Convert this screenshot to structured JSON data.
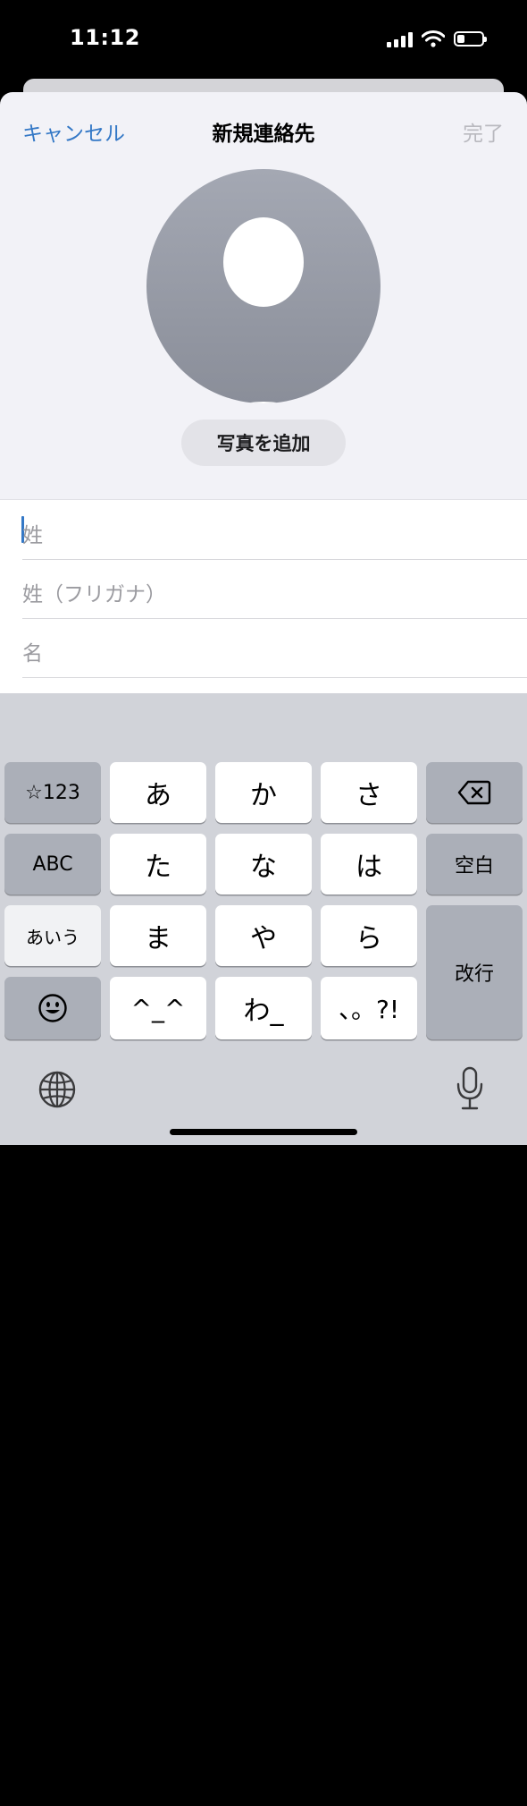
{
  "status_bar": {
    "time": "11:12"
  },
  "nav": {
    "cancel_label": "キャンセル",
    "title": "新規連絡先",
    "done_label": "完了"
  },
  "photo": {
    "add_label": "写真を追加"
  },
  "fields": [
    {
      "label": "姓"
    },
    {
      "label": "姓（フリガナ）"
    },
    {
      "label": "名"
    }
  ],
  "keyboard": {
    "left_column": [
      "☆123",
      "ABC",
      "あいう"
    ],
    "kana_keys": [
      "あ",
      "か",
      "さ",
      "た",
      "な",
      "は",
      "ま",
      "や",
      "ら",
      "^_^",
      "わ_",
      "、。?!"
    ],
    "space_label": "空白",
    "return_label": "改行"
  },
  "icons": [
    "wifi-icon",
    "battery-icon",
    "signal-icon",
    "avatar-placeholder-icon",
    "backspace-icon",
    "emoji-icon",
    "globe-icon",
    "microphone-icon"
  ],
  "colors": {
    "accent": "#3478c6",
    "sheet_bg": "#f2f2f7",
    "keyboard_bg": "#d1d3d9"
  }
}
